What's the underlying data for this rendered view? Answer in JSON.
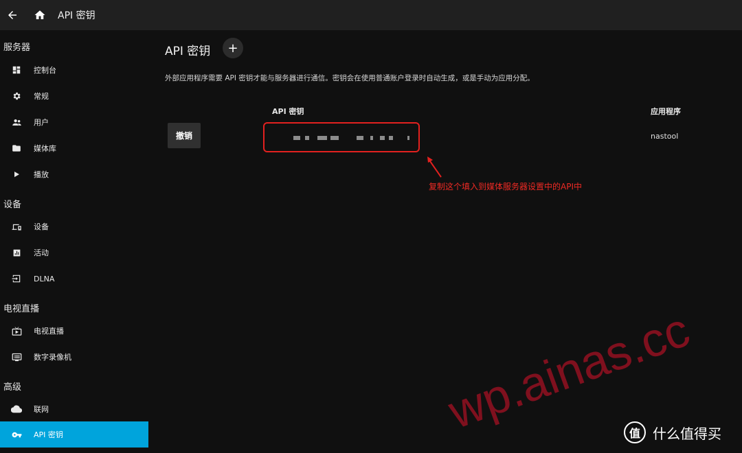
{
  "topbar": {
    "title": "API 密钥",
    "icons": [
      "back-arrow-icon",
      "home-icon"
    ]
  },
  "sidebar": {
    "sections": [
      {
        "title": "服务器",
        "items": [
          {
            "label": "控制台",
            "icon": "dashboard-icon"
          },
          {
            "label": "常规",
            "icon": "gear-icon"
          },
          {
            "label": "用户",
            "icon": "users-icon"
          },
          {
            "label": "媒体库",
            "icon": "folder-icon"
          },
          {
            "label": "播放",
            "icon": "play-icon"
          }
        ]
      },
      {
        "title": "设备",
        "items": [
          {
            "label": "设备",
            "icon": "devices-icon"
          },
          {
            "label": "活动",
            "icon": "activity-chart-icon"
          },
          {
            "label": "DLNA",
            "icon": "input-icon"
          }
        ]
      },
      {
        "title": "电视直播",
        "items": [
          {
            "label": "电视直播",
            "icon": "live-tv-icon"
          },
          {
            "label": "数字录像机",
            "icon": "dvr-icon"
          }
        ]
      },
      {
        "title": "高级",
        "items": [
          {
            "label": "联网",
            "icon": "cloud-icon"
          },
          {
            "label": "API 密钥",
            "icon": "key-icon",
            "active": true
          }
        ]
      }
    ]
  },
  "main": {
    "title": "API 密钥",
    "add_icon": "plus-icon",
    "description": "外部应用程序需要 API 密钥才能与服务器进行通信。密钥会在使用普通账户登录时自动生成，或是手动为应用分配。",
    "columns": {
      "key": "API 密钥",
      "app": "应用程序"
    },
    "rows": [
      {
        "revoke_label": "撤销",
        "app": "nastool"
      }
    ]
  },
  "annotation": {
    "text": "复制这个填入到媒体服务器设置中的API中",
    "color": "#e3211f"
  },
  "watermark": {
    "text": "wp.ainas.cc"
  },
  "badge": {
    "logo": "值",
    "text": "什么值得买"
  },
  "colors": {
    "accent": "#00a4dc",
    "background": "#101010",
    "topbar": "#202020"
  }
}
